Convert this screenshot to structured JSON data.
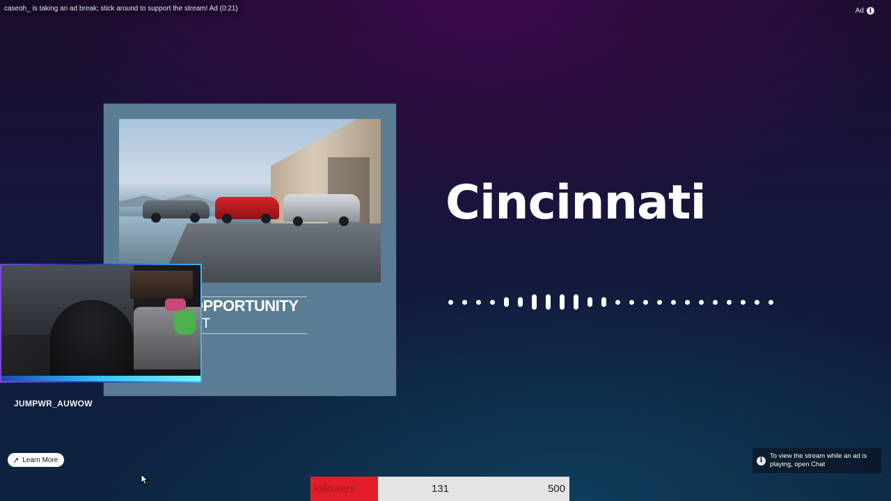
{
  "ad_notice": "caseoh_ is taking an ad break; stick around to support the stream! Ad (0:21)",
  "ad_tag": {
    "label": "Ad",
    "info_icon": "info-icon"
  },
  "ad_card": {
    "headline": "OPPORTUNITY",
    "subline": "NT",
    "background": "#5a7d93"
  },
  "streamer_name": "JUMPWR_AUWOW",
  "city_title": "Cincinnati",
  "audio_wave": {
    "levels": [
      1,
      1,
      1,
      1,
      2,
      2,
      3,
      3,
      3,
      3,
      2,
      2,
      1,
      1,
      1,
      1,
      1,
      1,
      1,
      1,
      1,
      1,
      1,
      1
    ]
  },
  "learn_more": {
    "label": "Learn More",
    "icon": "external-arrow-icon"
  },
  "chat_tip": {
    "text": "To view the stream while an ad is playing, open Chat"
  },
  "followers_goal": {
    "label": "followers",
    "current": "131",
    "goal": "500",
    "progress": 0.262,
    "fill_color": "#e21d27"
  }
}
